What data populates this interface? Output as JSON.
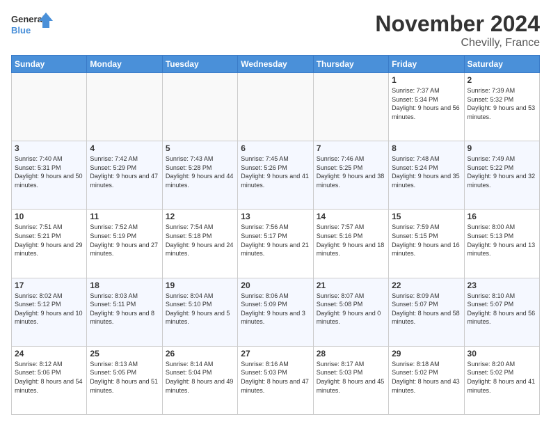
{
  "header": {
    "logo_line1": "General",
    "logo_line2": "Blue",
    "month": "November 2024",
    "location": "Chevilly, France"
  },
  "weekdays": [
    "Sunday",
    "Monday",
    "Tuesday",
    "Wednesday",
    "Thursday",
    "Friday",
    "Saturday"
  ],
  "weeks": [
    [
      {
        "day": "",
        "info": ""
      },
      {
        "day": "",
        "info": ""
      },
      {
        "day": "",
        "info": ""
      },
      {
        "day": "",
        "info": ""
      },
      {
        "day": "",
        "info": ""
      },
      {
        "day": "1",
        "info": "Sunrise: 7:37 AM\nSunset: 5:34 PM\nDaylight: 9 hours and 56 minutes."
      },
      {
        "day": "2",
        "info": "Sunrise: 7:39 AM\nSunset: 5:32 PM\nDaylight: 9 hours and 53 minutes."
      }
    ],
    [
      {
        "day": "3",
        "info": "Sunrise: 7:40 AM\nSunset: 5:31 PM\nDaylight: 9 hours and 50 minutes."
      },
      {
        "day": "4",
        "info": "Sunrise: 7:42 AM\nSunset: 5:29 PM\nDaylight: 9 hours and 47 minutes."
      },
      {
        "day": "5",
        "info": "Sunrise: 7:43 AM\nSunset: 5:28 PM\nDaylight: 9 hours and 44 minutes."
      },
      {
        "day": "6",
        "info": "Sunrise: 7:45 AM\nSunset: 5:26 PM\nDaylight: 9 hours and 41 minutes."
      },
      {
        "day": "7",
        "info": "Sunrise: 7:46 AM\nSunset: 5:25 PM\nDaylight: 9 hours and 38 minutes."
      },
      {
        "day": "8",
        "info": "Sunrise: 7:48 AM\nSunset: 5:24 PM\nDaylight: 9 hours and 35 minutes."
      },
      {
        "day": "9",
        "info": "Sunrise: 7:49 AM\nSunset: 5:22 PM\nDaylight: 9 hours and 32 minutes."
      }
    ],
    [
      {
        "day": "10",
        "info": "Sunrise: 7:51 AM\nSunset: 5:21 PM\nDaylight: 9 hours and 29 minutes."
      },
      {
        "day": "11",
        "info": "Sunrise: 7:52 AM\nSunset: 5:19 PM\nDaylight: 9 hours and 27 minutes."
      },
      {
        "day": "12",
        "info": "Sunrise: 7:54 AM\nSunset: 5:18 PM\nDaylight: 9 hours and 24 minutes."
      },
      {
        "day": "13",
        "info": "Sunrise: 7:56 AM\nSunset: 5:17 PM\nDaylight: 9 hours and 21 minutes."
      },
      {
        "day": "14",
        "info": "Sunrise: 7:57 AM\nSunset: 5:16 PM\nDaylight: 9 hours and 18 minutes."
      },
      {
        "day": "15",
        "info": "Sunrise: 7:59 AM\nSunset: 5:15 PM\nDaylight: 9 hours and 16 minutes."
      },
      {
        "day": "16",
        "info": "Sunrise: 8:00 AM\nSunset: 5:13 PM\nDaylight: 9 hours and 13 minutes."
      }
    ],
    [
      {
        "day": "17",
        "info": "Sunrise: 8:02 AM\nSunset: 5:12 PM\nDaylight: 9 hours and 10 minutes."
      },
      {
        "day": "18",
        "info": "Sunrise: 8:03 AM\nSunset: 5:11 PM\nDaylight: 9 hours and 8 minutes."
      },
      {
        "day": "19",
        "info": "Sunrise: 8:04 AM\nSunset: 5:10 PM\nDaylight: 9 hours and 5 minutes."
      },
      {
        "day": "20",
        "info": "Sunrise: 8:06 AM\nSunset: 5:09 PM\nDaylight: 9 hours and 3 minutes."
      },
      {
        "day": "21",
        "info": "Sunrise: 8:07 AM\nSunset: 5:08 PM\nDaylight: 9 hours and 0 minutes."
      },
      {
        "day": "22",
        "info": "Sunrise: 8:09 AM\nSunset: 5:07 PM\nDaylight: 8 hours and 58 minutes."
      },
      {
        "day": "23",
        "info": "Sunrise: 8:10 AM\nSunset: 5:07 PM\nDaylight: 8 hours and 56 minutes."
      }
    ],
    [
      {
        "day": "24",
        "info": "Sunrise: 8:12 AM\nSunset: 5:06 PM\nDaylight: 8 hours and 54 minutes."
      },
      {
        "day": "25",
        "info": "Sunrise: 8:13 AM\nSunset: 5:05 PM\nDaylight: 8 hours and 51 minutes."
      },
      {
        "day": "26",
        "info": "Sunrise: 8:14 AM\nSunset: 5:04 PM\nDaylight: 8 hours and 49 minutes."
      },
      {
        "day": "27",
        "info": "Sunrise: 8:16 AM\nSunset: 5:03 PM\nDaylight: 8 hours and 47 minutes."
      },
      {
        "day": "28",
        "info": "Sunrise: 8:17 AM\nSunset: 5:03 PM\nDaylight: 8 hours and 45 minutes."
      },
      {
        "day": "29",
        "info": "Sunrise: 8:18 AM\nSunset: 5:02 PM\nDaylight: 8 hours and 43 minutes."
      },
      {
        "day": "30",
        "info": "Sunrise: 8:20 AM\nSunset: 5:02 PM\nDaylight: 8 hours and 41 minutes."
      }
    ]
  ]
}
